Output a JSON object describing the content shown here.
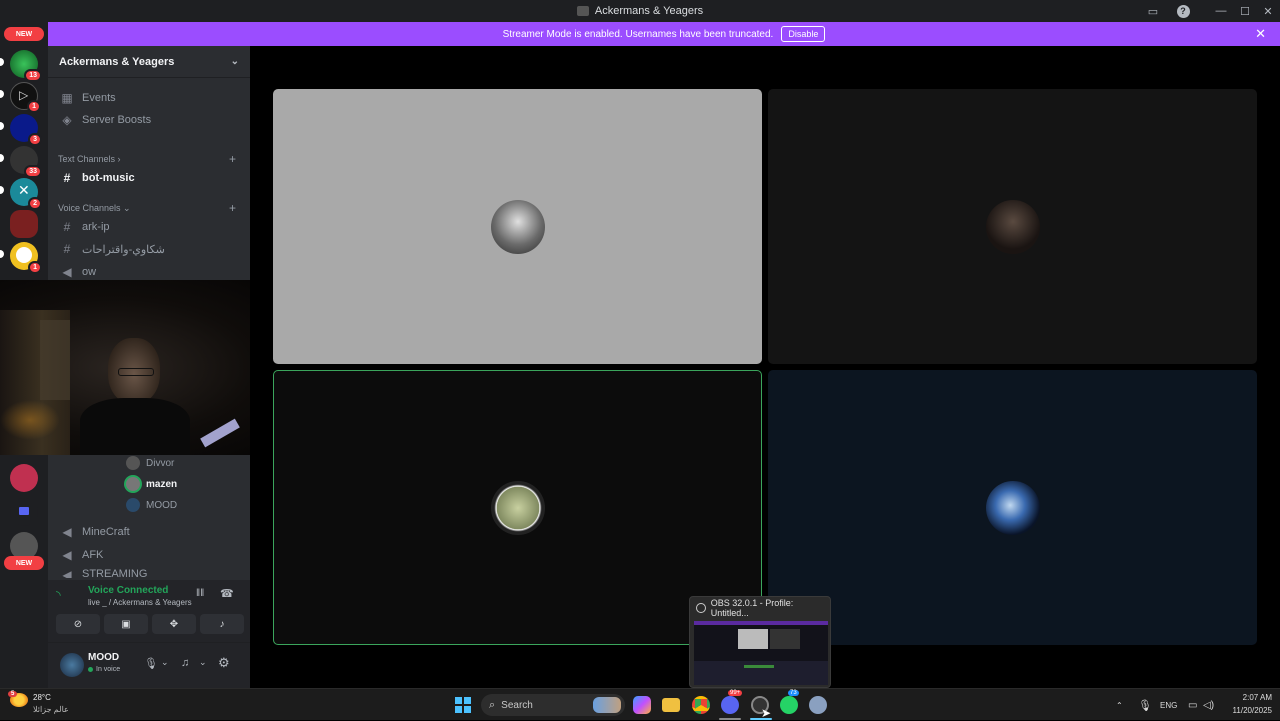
{
  "window": {
    "title": "Ackermans & Yeagers"
  },
  "banner": {
    "message": "Streamer Mode is enabled. Usernames have been truncated.",
    "disable_label": "Disable"
  },
  "servers": {
    "new_label_top": "NEW",
    "new_label_bottom": "NEW",
    "badges": [
      "13",
      "1",
      "3",
      "33",
      "2",
      "1"
    ]
  },
  "guild": {
    "name": "Ackermans & Yeagers",
    "events_label": "Events",
    "boosts_label": "Server Boosts",
    "text_category": "Text Channels",
    "text_channels": [
      "bot-music"
    ],
    "voice_category": "Voice Channels",
    "voice_channels_top": [
      "ark-ip",
      "شكاوي-واقتراحات",
      "ow"
    ],
    "voice_users": [
      "Divvor",
      "mazen",
      "MOOD"
    ],
    "voice_channels_bottom": [
      "MineCraft",
      "AFK",
      "STREAMING"
    ]
  },
  "voice_panel": {
    "status": "Voice Connected",
    "detail": "live _ / Ackermans & Yeagers"
  },
  "user_panel": {
    "name": "MOOD",
    "status": "In voice"
  },
  "taskbar": {
    "weather_temp": "28°C",
    "weather_desc": "عالم جزائلا",
    "weather_badge": "5",
    "search_placeholder": "Search",
    "discord_badge": "99+",
    "whatsapp_badge": "73",
    "lang": "ENG",
    "time": "2:07 AM",
    "date": "11/20/2025"
  },
  "obs_preview": {
    "title": "OBS 32.0.1 - Profile: Untitled..."
  },
  "colors": {
    "accent": "#9b4dff",
    "discord_blurple": "#5865f2",
    "voice_green": "#23a55a",
    "danger_red": "#f23f43"
  }
}
